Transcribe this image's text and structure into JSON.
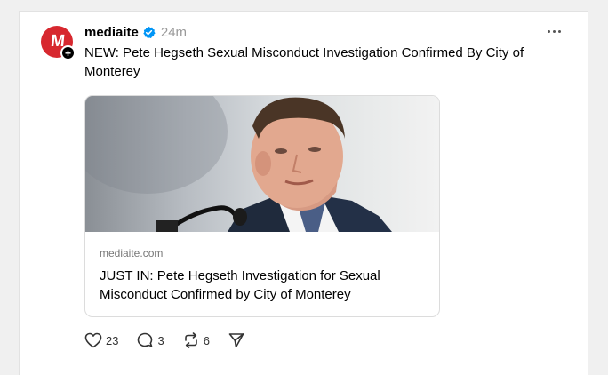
{
  "post": {
    "avatar_text": "M",
    "follow_symbol": "+",
    "username": "mediaite",
    "timestamp": "24m",
    "text": "NEW: Pete Hegseth Sexual Misconduct Investigation Confirmed By City of Monterey"
  },
  "link_card": {
    "domain": "mediaite.com",
    "title": "JUST IN: Pete Hegseth Investigation for Sexual Misconduct Confirmed by City of Monterey"
  },
  "actions": {
    "likes": "23",
    "replies": "3",
    "reposts": "6"
  },
  "icons": {
    "verified": "verified-check-icon",
    "more": "more-options-icon",
    "like": "heart-icon",
    "reply": "comment-bubble-icon",
    "repost": "repost-icon",
    "share": "send-icon"
  },
  "colors": {
    "brand_red": "#d7282f",
    "verified_blue": "#0095f6",
    "muted_text": "#999999"
  }
}
